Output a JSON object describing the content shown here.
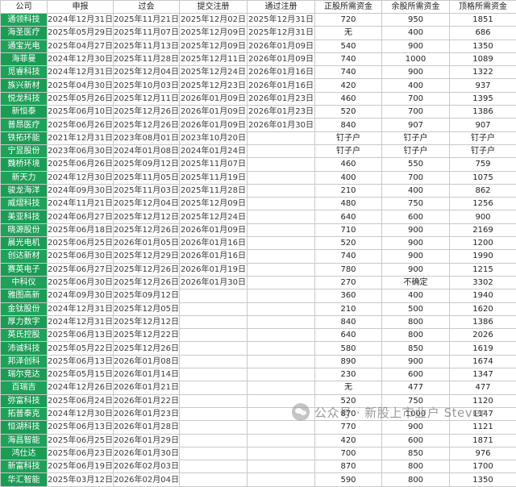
{
  "headers": [
    "公司",
    "申报",
    "过会",
    "提交注册",
    "通过注册",
    "正股所需资金",
    "余股所需资金",
    "顶格所需资金"
  ],
  "rows": [
    [
      "通领科技",
      "2024年12月31日",
      "2025年11月21日",
      "2025年12月02日",
      "2025年12月31日",
      "720",
      "950",
      "1851"
    ],
    [
      "海圣医疗",
      "2025年05月29日",
      "2025年11月07日",
      "2025年12月09日",
      "2025年12月31日",
      "无",
      "400",
      "686"
    ],
    [
      "通宝光电",
      "2025年04月27日",
      "2025年11月13日",
      "2025年12月09日",
      "2026年01月09日",
      "540",
      "900",
      "1350"
    ],
    [
      "海菲曼",
      "2024年12月30日",
      "2025年11月28日",
      "2025年12月11日",
      "2026年01月09日",
      "740",
      "1000",
      "1089"
    ],
    [
      "觅睿科技",
      "2024年12月31日",
      "2025年12月04日",
      "2025年12月24日",
      "2026年01月16日",
      "740",
      "900",
      "1322"
    ],
    [
      "族兴新材",
      "2025年04月30日",
      "2025年10月03日",
      "2025年12月23日",
      "2026年01月16日",
      "420",
      "400",
      "937"
    ],
    [
      "悦龙科技",
      "2025年05月26日",
      "2025年12月11日",
      "2026年01月09日",
      "2026年01月23日",
      "460",
      "700",
      "1395"
    ],
    [
      "新恒泰",
      "2025年06月10日",
      "2025年12月26日",
      "2026年01月09日",
      "2026年01月23日",
      "520",
      "700",
      "1386"
    ],
    [
      "普昂医疗",
      "2025年06月26日",
      "2025年12月26日",
      "2026年01月09日",
      "2026年01月30日",
      "840",
      "907",
      "907"
    ],
    [
      "铁拓环能",
      "2021年12月31日",
      "2023年08月01日",
      "2023年10月20日",
      "",
      "钉子户",
      "钉子户",
      "钉子户"
    ],
    [
      "宁昱股份",
      "2023年06月30日",
      "2024年01月08日",
      "2024年01月24日",
      "",
      "钉子户",
      "钉子户",
      "钉子户"
    ],
    [
      "魏桥环境",
      "2025年06月26日",
      "2025年09月12日",
      "2025年11月07日",
      "",
      "460",
      "550",
      "759"
    ],
    [
      "新天力",
      "2024年12月30日",
      "2025年11月05日",
      "2025年11月19日",
      "",
      "400",
      "700",
      "1075"
    ],
    [
      "骏龙海洋",
      "2024年09月30日",
      "2025年11月03日",
      "2025年11月28日",
      "",
      "210",
      "400",
      "862"
    ],
    [
      "威熠科技",
      "2024年11月21日",
      "2025年12月04日",
      "2025年12月09日",
      "",
      "480",
      "750",
      "1256"
    ],
    [
      "美亚科技",
      "2024年06月27日",
      "2025年12月12日",
      "2025年12月24日",
      "",
      "640",
      "600",
      "900"
    ],
    [
      "晓源股份",
      "2025年06月18日",
      "2025年12月26日",
      "2026年01月09日",
      "",
      "710",
      "900",
      "2169"
    ],
    [
      "晨光电机",
      "2025年06月25日",
      "2026年01月05日",
      "2026年01月16日",
      "",
      "520",
      "900",
      "1200"
    ],
    [
      "创达新材",
      "2025年06月30日",
      "2025年12月29日",
      "2026年01月16日",
      "",
      "740",
      "900",
      "1990"
    ],
    [
      "赛英电子",
      "2025年06月27日",
      "2025年12月26日",
      "2026年01月19日",
      "",
      "780",
      "900",
      "1215"
    ],
    [
      "中科仪",
      "2025年06月30日",
      "2025年12月26日",
      "2026年01月30日",
      "",
      "270",
      "不确定",
      "3302"
    ],
    [
      "雅图高新",
      "2024年09月30日",
      "2025年09月12日",
      "",
      "",
      "360",
      "400",
      "1940"
    ],
    [
      "金钛股份",
      "2024年12月31日",
      "2025年12月05日",
      "",
      "",
      "210",
      "500",
      "1620"
    ],
    [
      "厚力数字",
      "2024年12月31日",
      "2025年12月12日",
      "",
      "",
      "840",
      "800",
      "1386"
    ],
    [
      "英氏控股",
      "2025年06月13日",
      "2025年12月22日",
      "",
      "",
      "640",
      "800",
      "2026"
    ],
    [
      "沛诚科技",
      "2025年05月22日",
      "2025年12月26日",
      "",
      "",
      "580",
      "850",
      "1619"
    ],
    [
      "邦泽创科",
      "2025年06月13日",
      "2026年01月08日",
      "",
      "",
      "890",
      "900",
      "1674"
    ],
    [
      "瑞尔竞达",
      "2025年05月15日",
      "2026年01月14日",
      "",
      "",
      "230",
      "600",
      "1347"
    ],
    [
      "百瑞吉",
      "2024年12月26日",
      "2026年01月21日",
      "",
      "",
      "无",
      "477",
      "477"
    ],
    [
      "弥富科技",
      "2025年06月24日",
      "2026年01月22日",
      "",
      "",
      "520",
      "750",
      "1120"
    ],
    [
      "拓普泰克",
      "2024年12月30日",
      "2026年01月23日",
      "",
      "",
      "870",
      "1000",
      "1147"
    ],
    [
      "恒湖科技",
      "2025年06月13日",
      "2026年01月28日",
      "",
      "",
      "770",
      "900",
      "1121"
    ],
    [
      "海昌智能",
      "2025年06月25日",
      "2026年01月29日",
      "",
      "",
      "420",
      "600",
      "1871"
    ],
    [
      "鸿仕达",
      "2025年06月23日",
      "2026年01月30日",
      "",
      "",
      "700",
      "850",
      "976"
    ],
    [
      "新富科技",
      "2025年06月19日",
      "2026年02月03日",
      "",
      "",
      "870",
      "800",
      "1700"
    ],
    [
      "华汇智能",
      "2025年03月12日",
      "2026年02月04日",
      "",
      "",
      "590",
      "800",
      "1350"
    ]
  ],
  "watermark": {
    "text": "公众号 · 新股上市业户 Steven"
  },
  "colors": {
    "name_bg": "#1ea25a",
    "name_text": "#ffffff",
    "border": "#c9c9c9"
  }
}
